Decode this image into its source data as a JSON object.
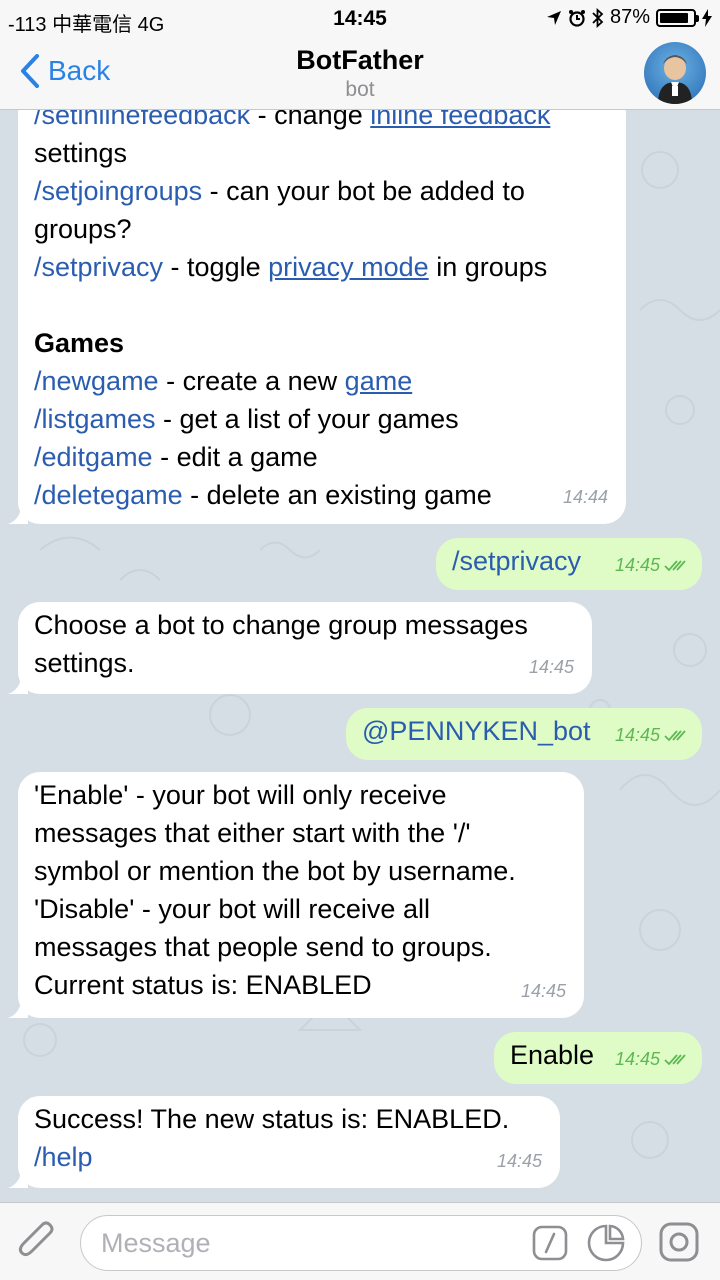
{
  "status_bar": {
    "carrier": "-113 中華電信  4G",
    "time": "14:45",
    "battery": "87%",
    "battery_level": 0.87
  },
  "nav": {
    "back_label": "Back",
    "title": "BotFather",
    "subtitle": "bot"
  },
  "messages": {
    "m1": {
      "line0_cmd": "/setinlinefeedback",
      "line0_mid": " - change ",
      "line0_link": "inline feedback",
      "line1": "settings",
      "line2_cmd": "/setjoingroups",
      "line2_rest": " - can your bot be added to",
      "line3": "groups?",
      "line4_cmd": "/setprivacy",
      "line4_mid": " - toggle ",
      "line4_link": "privacy mode",
      "line4_rest": " in groups",
      "heading": "Games",
      "line6_cmd": "/newgame",
      "line6_mid": " - create a new ",
      "line6_link": "game",
      "line7_cmd": "/listgames",
      "line7_rest": " - get a list of your games",
      "line8_cmd": "/editgame",
      "line8_rest": " - edit a game",
      "line9_cmd": "/deletegame",
      "line9_rest": " - delete an existing game",
      "time": "14:44"
    },
    "m2": {
      "text": "/setprivacy",
      "time": "14:45"
    },
    "m3": {
      "line1": "Choose a bot to change group messages",
      "line2": "settings.",
      "time": "14:45"
    },
    "m4": {
      "text": "@PENNYKEN_bot",
      "time": "14:45"
    },
    "m5": {
      "line1": "'Enable' - your bot will only receive",
      "line2": "messages that either start with the '/'",
      "line3": "symbol or mention the bot by username.",
      "line4": "'Disable' - your bot will receive all",
      "line5": "messages that people send to groups.",
      "line6": "Current status is: ENABLED",
      "time": "14:45"
    },
    "m6": {
      "text": "Enable",
      "time": "14:45"
    },
    "m7": {
      "line1": "Success! The new status is: ENABLED.",
      "line2": "/help",
      "time": "14:45"
    }
  },
  "input": {
    "placeholder": "Message"
  },
  "icons": {
    "attach": "paperclip-icon",
    "commands": "slash-command-icon",
    "sticker": "sticker-icon",
    "camera": "camera-icon"
  },
  "colors": {
    "accent": "#2a82e4",
    "link": "#2a5db0",
    "incoming": "#ffffff",
    "outgoing": "#e0fcc6",
    "chat_bg": "#d6dee5"
  }
}
